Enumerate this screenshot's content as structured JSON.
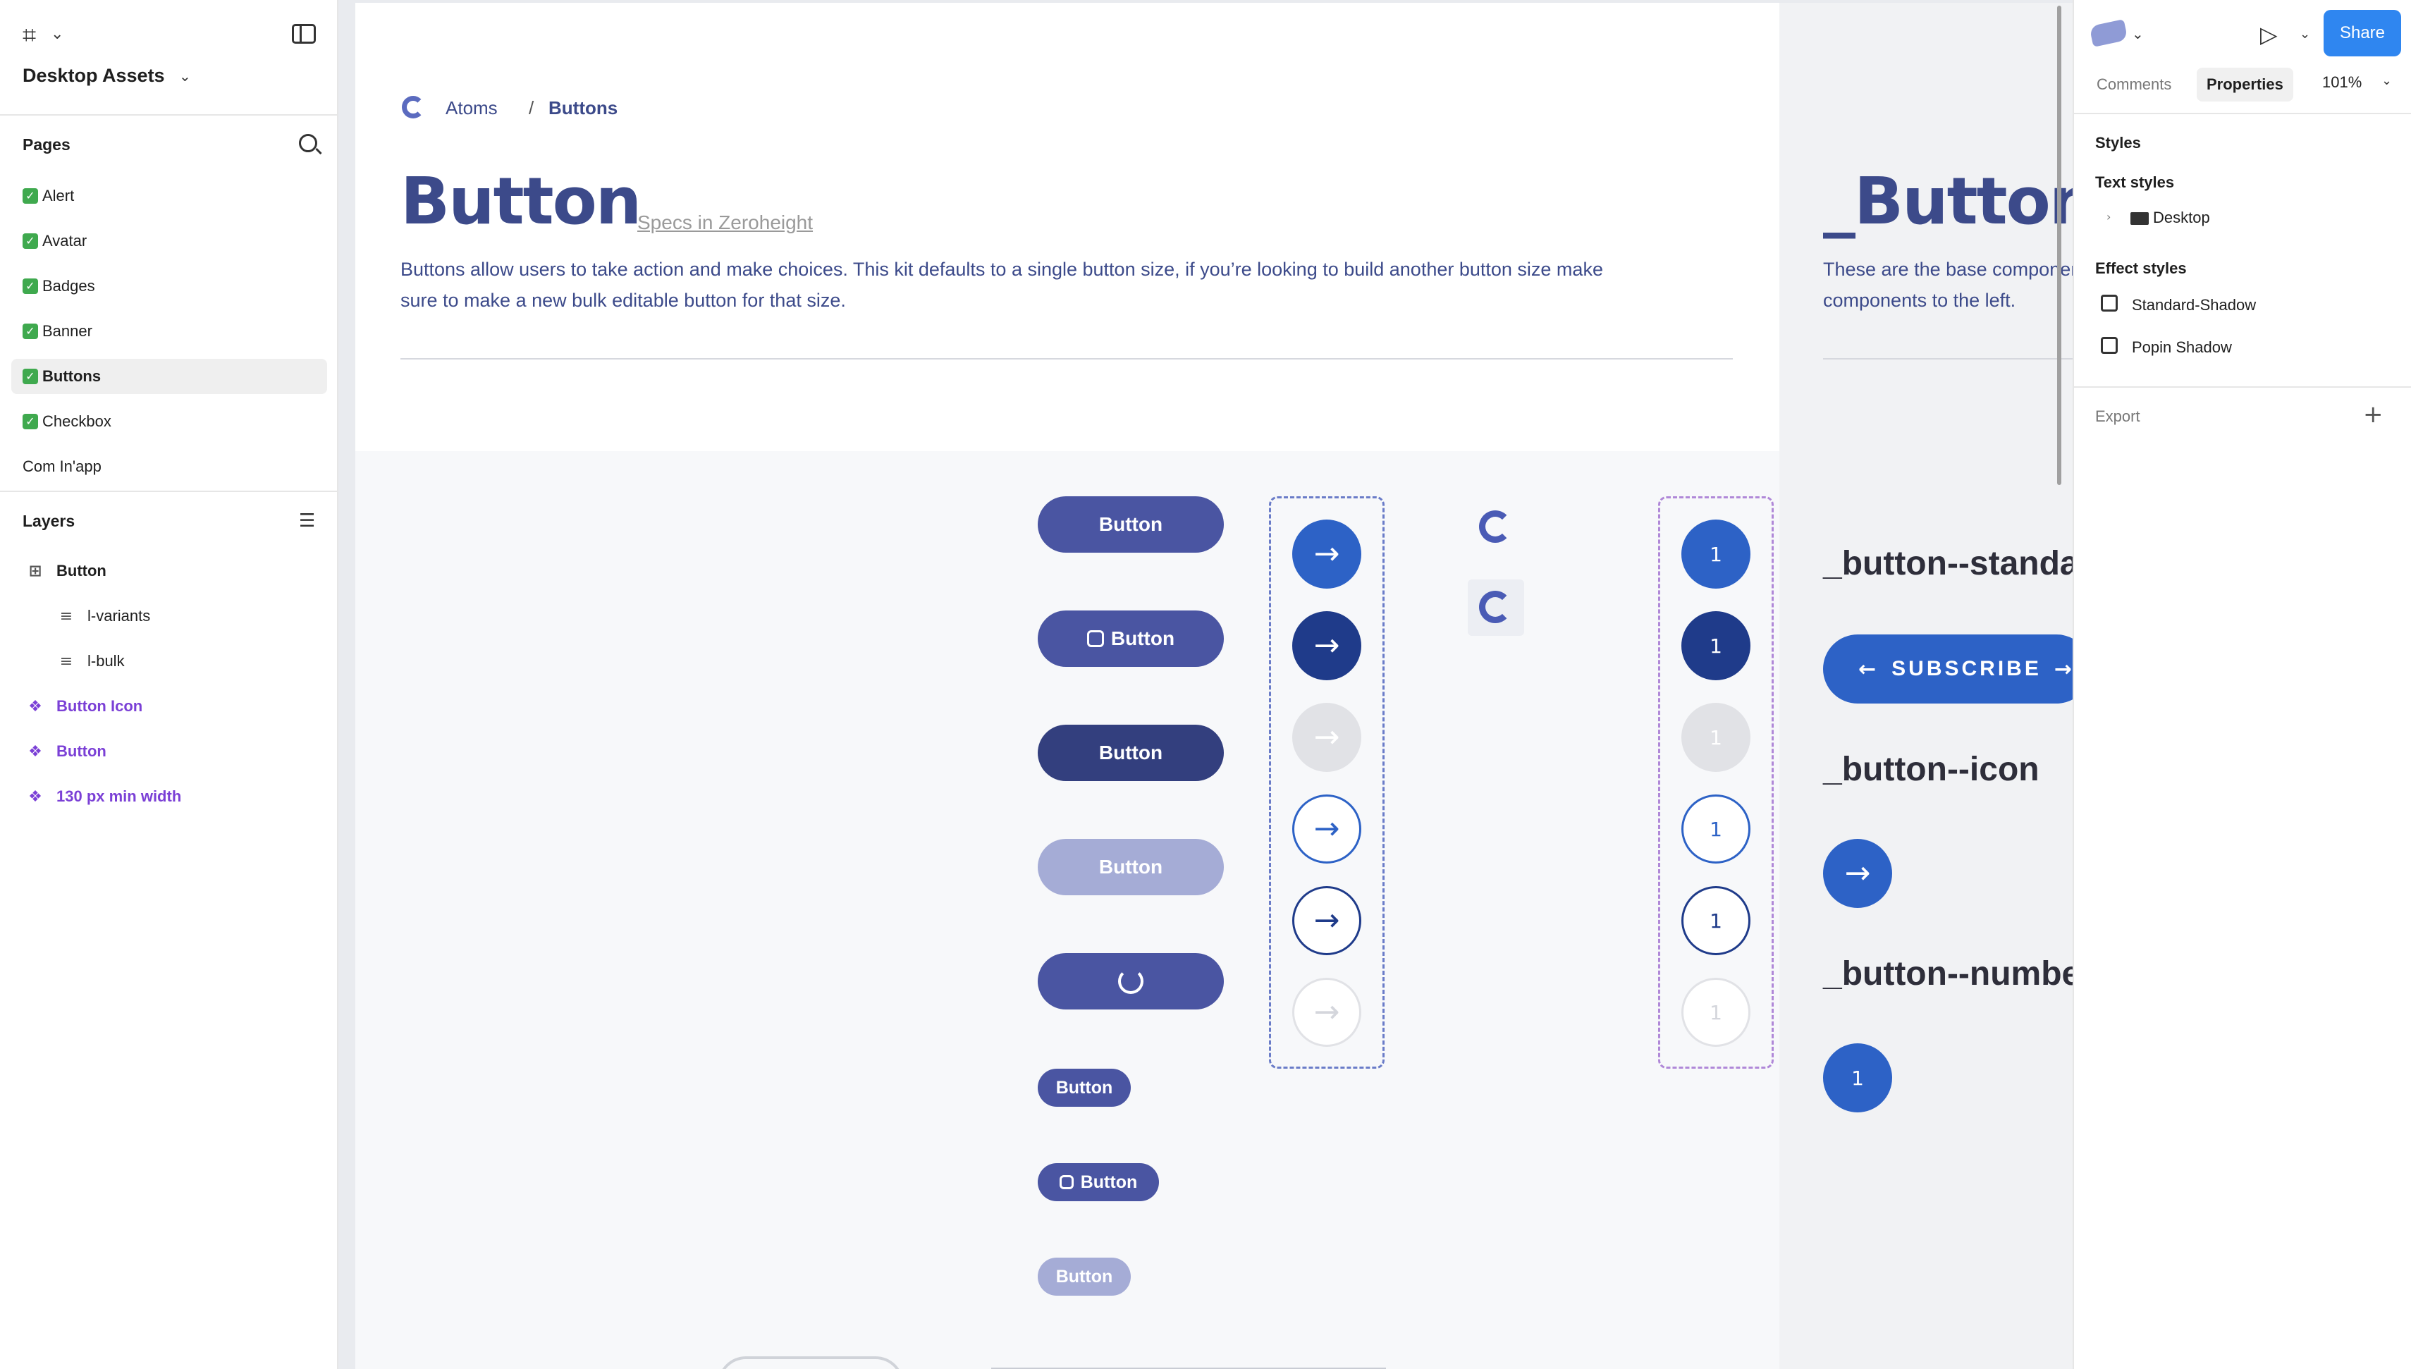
{
  "file": {
    "title": "Desktop Assets"
  },
  "pages": {
    "title": "Pages",
    "items": [
      {
        "label": "Alert",
        "done": true
      },
      {
        "label": "Avatar",
        "done": true
      },
      {
        "label": "Badges",
        "done": true
      },
      {
        "label": "Banner",
        "done": true
      },
      {
        "label": "Buttons",
        "done": true,
        "selected": true
      },
      {
        "label": "Checkbox",
        "done": true
      },
      {
        "label": "Com In'app",
        "done": false
      }
    ]
  },
  "layers": {
    "title": "Layers",
    "items": [
      {
        "label": "Button",
        "icon": "frame-icon"
      },
      {
        "label": "l-variants",
        "icon": "auto-layout-icon"
      },
      {
        "label": "l-bulk",
        "icon": "auto-layout-icon"
      },
      {
        "label": "Button Icon",
        "icon": "component-icon"
      },
      {
        "label": "Button",
        "icon": "component-icon"
      },
      {
        "label": "130 px min width",
        "icon": "component-icon"
      }
    ]
  },
  "canvas": {
    "breadcrumb": {
      "parent": "Atoms",
      "separator": "/",
      "current": "Buttons"
    },
    "heading": "Button",
    "specs_link": "Specs in Zeroheight",
    "description": "Buttons allow users to take action and make choices. This kit defaults to a single button size, if you’re looking to build another button size make sure to make a new bulk editable button for that size.",
    "buttons": [
      "Button",
      "Button",
      "Button",
      "Button",
      "Button",
      "Button",
      "Button"
    ],
    "numbers": [
      "1",
      "1",
      "1",
      "1",
      "1",
      "1"
    ],
    "right": {
      "heading": "_Button",
      "description_line1": "These are the base components",
      "description_line2": "components to the left.",
      "label_standard": "_button--standard",
      "subscribe": "SUBSCRIBE",
      "label_icon": "_button--icon",
      "label_number": "_button--number",
      "number": "1"
    }
  },
  "right_panel": {
    "share": "Share",
    "tabs": [
      "Comments",
      "Properties"
    ],
    "zoom": "101%",
    "styles_title": "Styles",
    "text_styles_title": "Text styles",
    "text_style": "Desktop",
    "effect_styles_title": "Effect styles",
    "effect_styles": [
      "Standard-Shadow",
      "Popin Shadow"
    ],
    "export": "Export"
  },
  "colors": {
    "primary": "#4a55a2",
    "primary_dark": "#2f3c7e",
    "disabled": "#a5acd6",
    "blue": "#2d62c6",
    "navy": "#1f3b8a",
    "share": "#2f86f0",
    "component": "#7b40d6"
  }
}
